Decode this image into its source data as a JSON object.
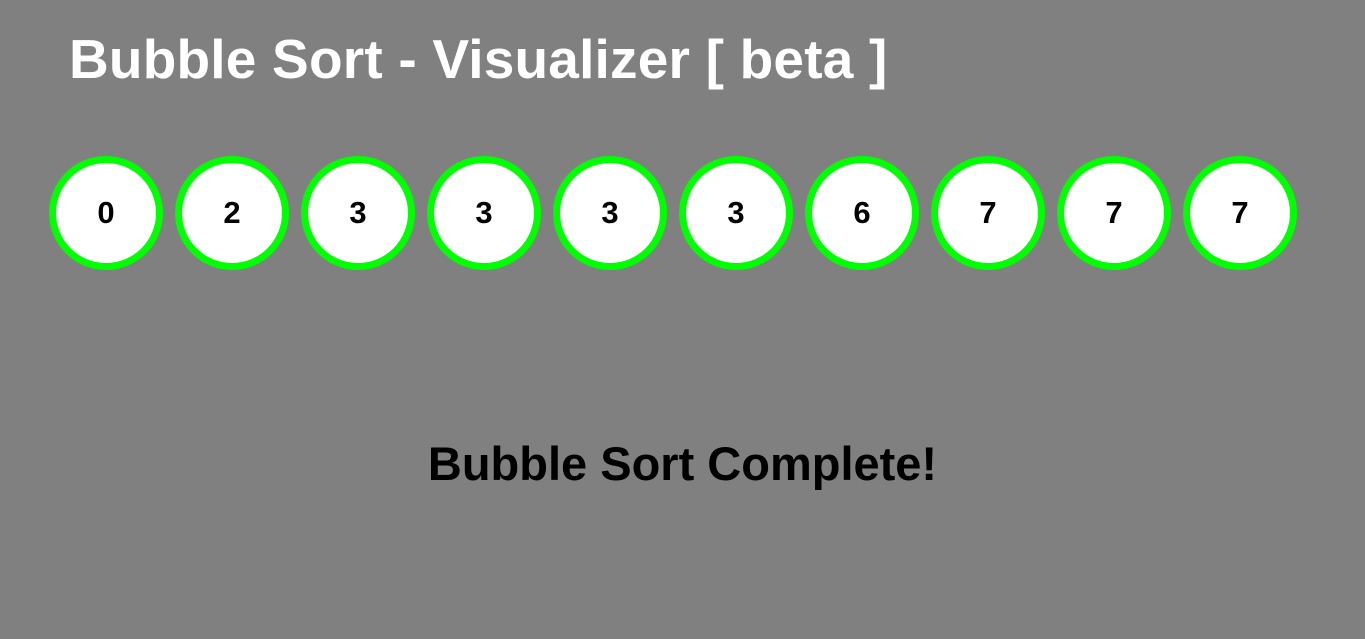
{
  "header": {
    "title": "Bubble Sort - Visualizer [ beta ]"
  },
  "array": {
    "values": [
      0,
      2,
      3,
      3,
      3,
      3,
      6,
      7,
      7,
      7
    ],
    "state": "sorted"
  },
  "status": {
    "message": "Bubble Sort Complete!"
  },
  "colors": {
    "background": "#808080",
    "bubble_fill": "#ffffff",
    "bubble_border_sorted": "#00ff00",
    "title_text": "#ffffff",
    "value_text": "#000000",
    "status_text": "#000000"
  }
}
